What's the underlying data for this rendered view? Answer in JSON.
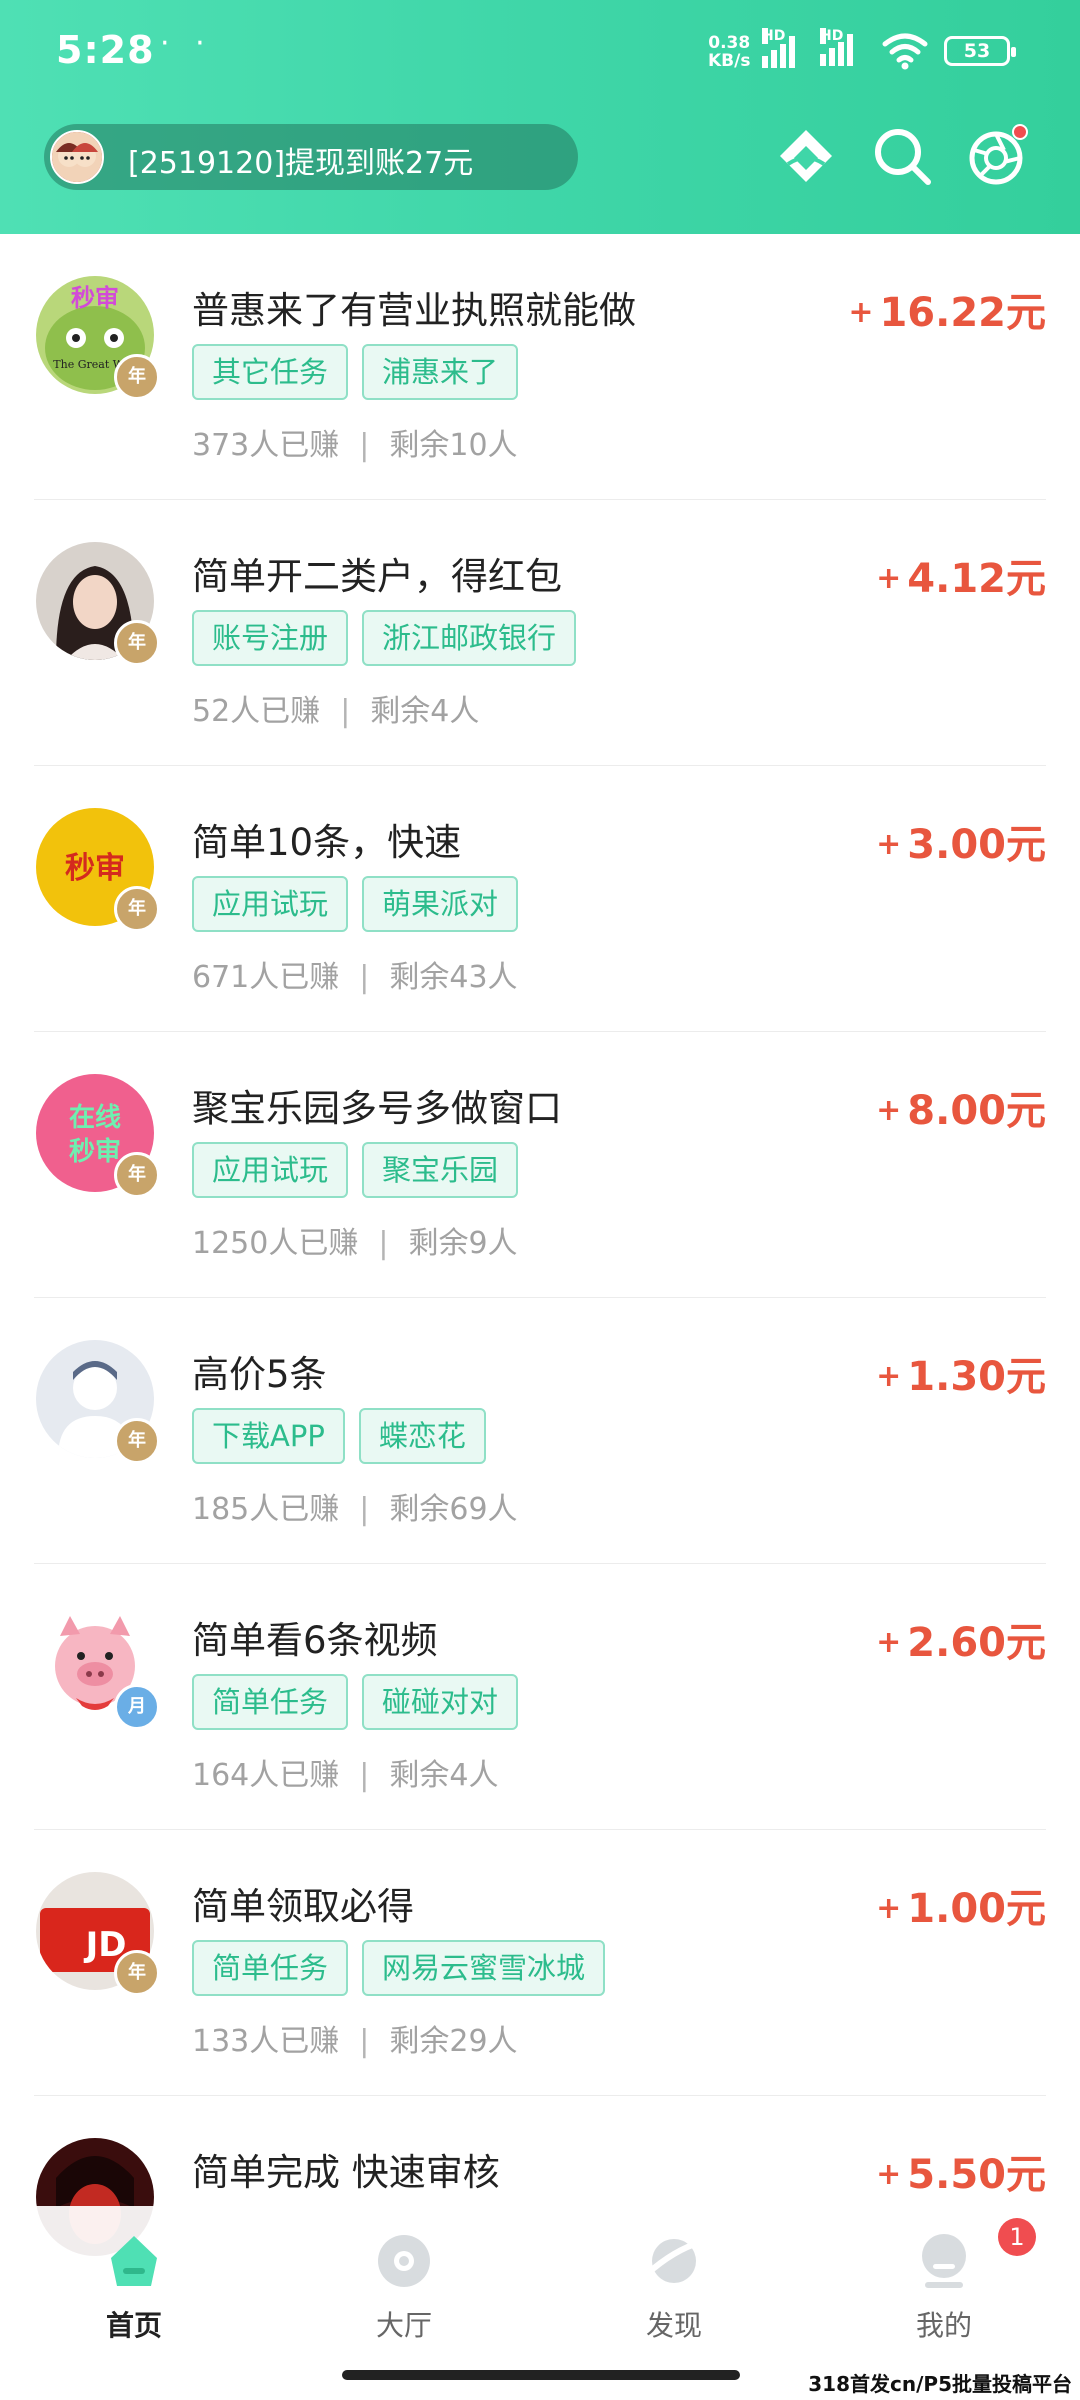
{
  "status_bar": {
    "time": "5:28",
    "dots": "· ·",
    "net_speed_value": "0.38",
    "net_speed_unit": "KB/s",
    "hd_1": "HD",
    "hd_2": "HD",
    "battery": "53"
  },
  "header": {
    "notice_text": "[2519120]提现到账27元",
    "icons": [
      "app-logo-icon",
      "search-icon",
      "settings-lens-icon"
    ]
  },
  "tasks": [
    {
      "title": "普惠来了有营业执照就能做",
      "reward": "16.22元",
      "plus": "+",
      "tags": [
        "其它任务",
        "浦惠来了"
      ],
      "earned": "373人已赚",
      "remaining": "剩余10人",
      "avatar_text": "秒审",
      "badge": "年"
    },
    {
      "title": "简单开二类户，得红包",
      "reward": "4.12元",
      "plus": "+",
      "tags": [
        "账号注册",
        "浙江邮政银行"
      ],
      "earned": "52人已赚",
      "remaining": "剩余4人",
      "avatar_text": "",
      "badge": "年"
    },
    {
      "title": "简单10条，快速",
      "reward": "3.00元",
      "plus": "+",
      "tags": [
        "应用试玩",
        "萌果派对"
      ],
      "earned": "671人已赚",
      "remaining": "剩余43人",
      "avatar_text": "秒审",
      "badge": "年"
    },
    {
      "title": "聚宝乐园多号多做窗口",
      "reward": "8.00元",
      "plus": "+",
      "tags": [
        "应用试玩",
        "聚宝乐园"
      ],
      "earned": "1250人已赚",
      "remaining": "剩余9人",
      "avatar_text": "在线秒审",
      "badge": "年"
    },
    {
      "title": "高价5条",
      "reward": "1.30元",
      "plus": "+",
      "tags": [
        "下载APP",
        "蝶恋花"
      ],
      "earned": "185人已赚",
      "remaining": "剩余69人",
      "avatar_text": "",
      "badge": "年"
    },
    {
      "title": "简单看6条视频",
      "reward": "2.60元",
      "plus": "+",
      "tags": [
        "简单任务",
        "碰碰对对"
      ],
      "earned": "164人已赚",
      "remaining": "剩余4人",
      "avatar_text": "",
      "badge": "月"
    },
    {
      "title": "简单领取必得",
      "reward": "1.00元",
      "plus": "+",
      "tags": [
        "简单任务",
        "网易云蜜雪冰城"
      ],
      "earned": "133人已赚",
      "remaining": "剩余29人",
      "avatar_text": "JD",
      "badge": "年"
    },
    {
      "title": "简单完成 快速审核",
      "reward": "5.50元",
      "plus": "+",
      "tags": [],
      "earned": "",
      "remaining": "",
      "avatar_text": "",
      "badge": ""
    }
  ],
  "stats_separator": "|",
  "bottom_nav": {
    "items": [
      {
        "label": "首页",
        "active": true
      },
      {
        "label": "大厅",
        "active": false
      },
      {
        "label": "发现",
        "active": false
      },
      {
        "label": "我的",
        "active": false
      }
    ],
    "mine_badge": "1"
  },
  "watermark": "318首发cn/P5批量投稿平台",
  "colors": {
    "header_green": "#3fd6a8",
    "reward_red": "#e8563e",
    "tag_green": "#2cbc8c",
    "badge_red": "#f04d50"
  }
}
